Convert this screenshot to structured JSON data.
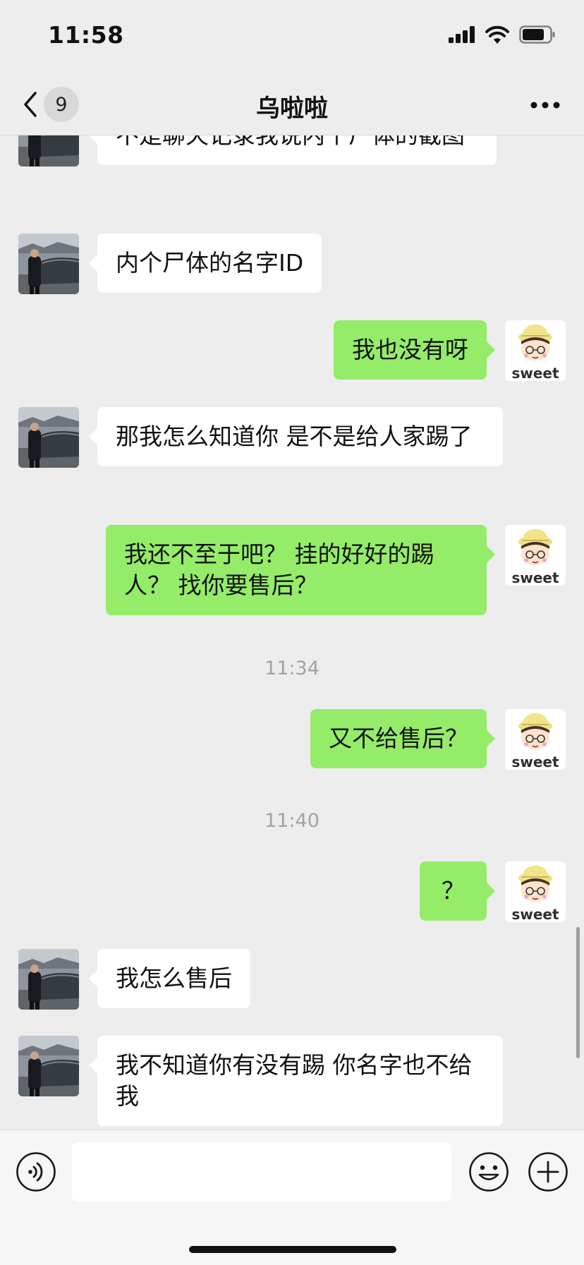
{
  "status_bar": {
    "time": "11:58",
    "battery_level": 0.8
  },
  "nav": {
    "unread_count": "9",
    "title": "乌啦啦"
  },
  "avatars": {
    "self_caption": "sweet"
  },
  "messages": [
    {
      "side": "left",
      "text": "不是聊天记录我说内个尸体的截图"
    },
    {
      "side": "left",
      "text": "内个尸体的名字ID"
    },
    {
      "side": "right",
      "text": "我也没有呀"
    },
    {
      "side": "left",
      "text": "那我怎么知道你 是不是给人家踢了"
    },
    {
      "side": "right",
      "text": "我还不至于吧？ 挂的好好的踢人？ 找你要售后？"
    },
    {
      "time": "11:34"
    },
    {
      "side": "right",
      "text": "又不给售后？"
    },
    {
      "time": "11:40"
    },
    {
      "side": "right",
      "text": "？"
    },
    {
      "side": "left",
      "text": "我怎么售后"
    },
    {
      "side": "left",
      "text": "我不知道你有没有踢 你名字也不给我"
    }
  ],
  "input": {
    "value": ""
  },
  "colors": {
    "self_bubble": "#95ec69",
    "other_bubble": "#ffffff",
    "background": "#ededed"
  }
}
